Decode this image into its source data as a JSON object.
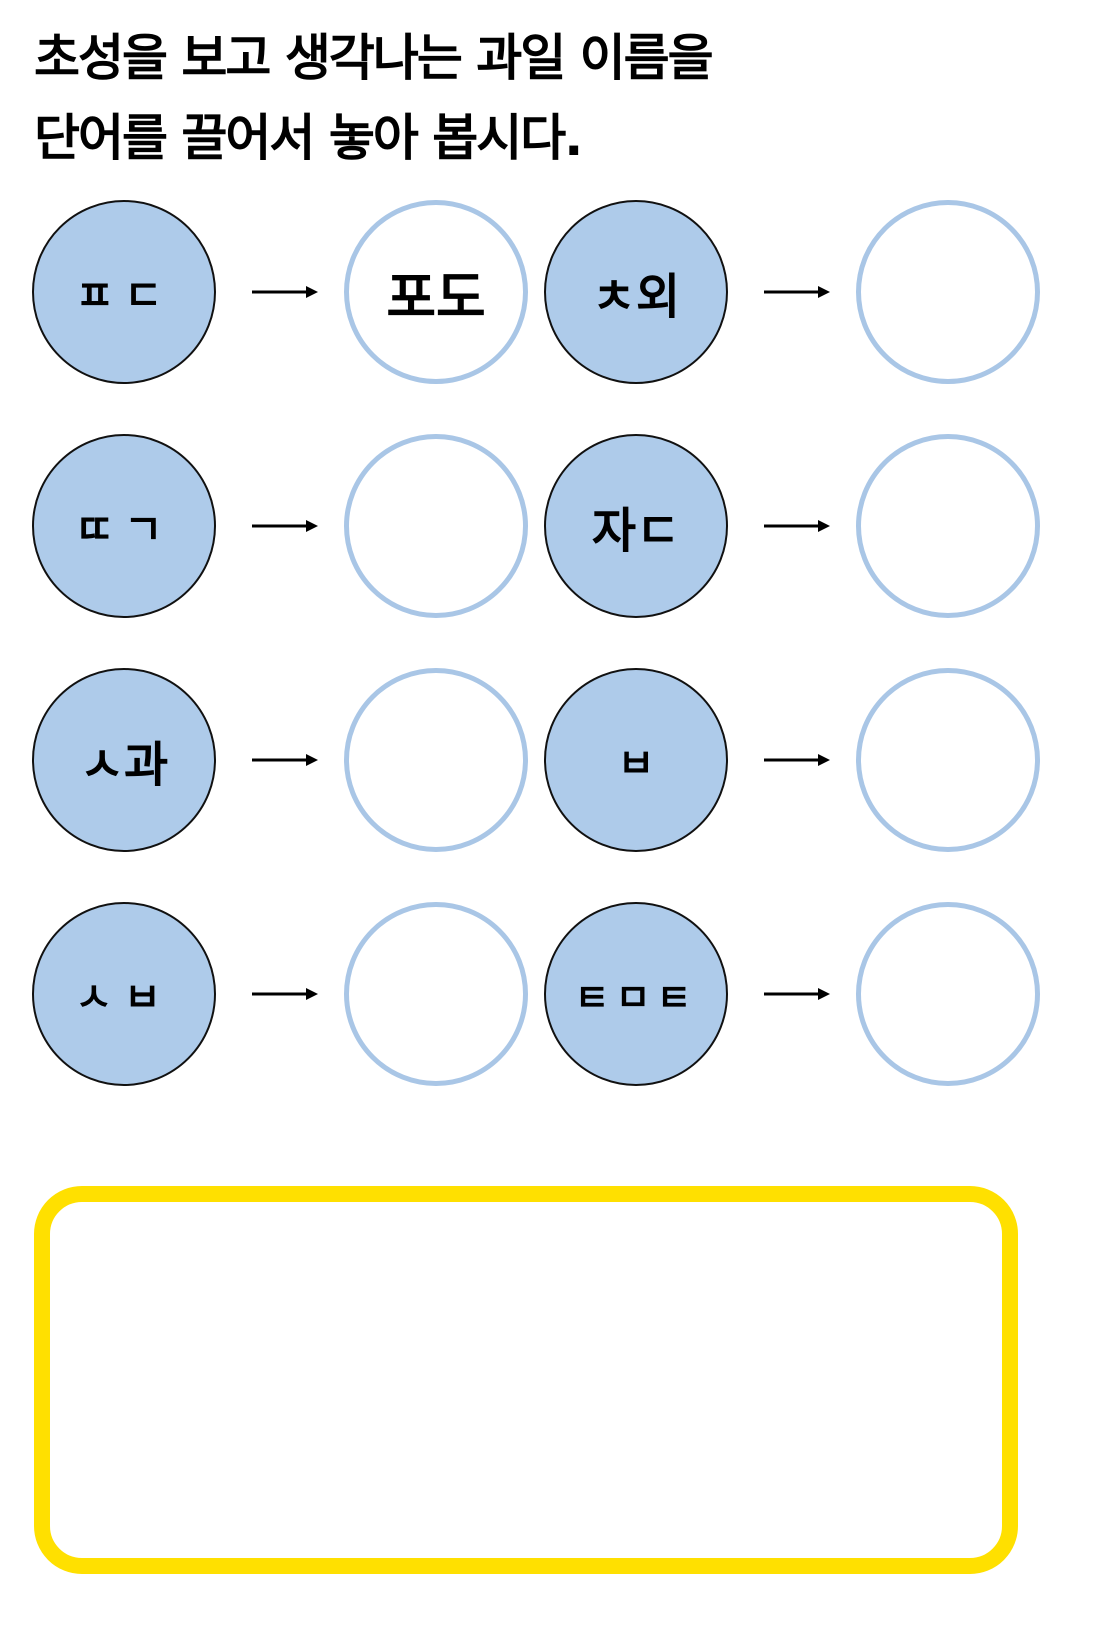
{
  "instruction": {
    "line1": "초성을 보고 생각나는 과일 이름을",
    "line2": "단어를 끌어서 놓아 봅시다."
  },
  "colors": {
    "hint_fill": "#aecbea",
    "answer_ring": "#a9c6e6",
    "tray_border": "#ffe000"
  },
  "icons": {
    "arrow": "right-arrow-icon"
  },
  "pairs": [
    {
      "hint": "ㅍㄷ",
      "answer": "포도"
    },
    {
      "hint": "ㅊ외",
      "answer": ""
    },
    {
      "hint": "ㄸㄱ",
      "answer": ""
    },
    {
      "hint": "자ㄷ",
      "answer": ""
    },
    {
      "hint": "ㅅ과",
      "answer": ""
    },
    {
      "hint": "ㅂ",
      "answer": ""
    },
    {
      "hint": "ㅅㅂ",
      "answer": ""
    },
    {
      "hint": "ㅌㅁㅌ",
      "answer": ""
    }
  ]
}
